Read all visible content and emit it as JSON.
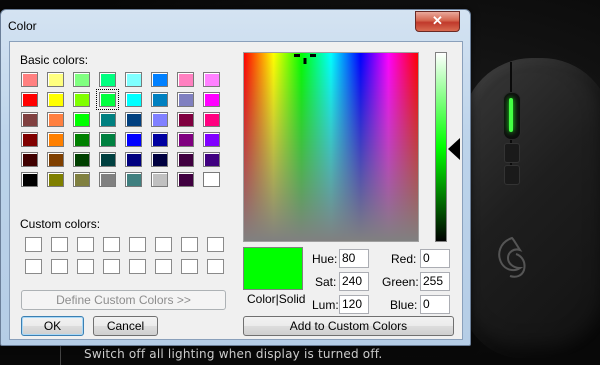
{
  "dialog": {
    "title": "Color",
    "close_glyph": "✕",
    "basic_colors_label": "Basic colors:",
    "custom_colors_label": "Custom colors:",
    "define_custom_label": "Define Custom Colors >>",
    "ok_label": "OK",
    "cancel_label": "Cancel",
    "color_solid_label": "Color|Solid",
    "add_custom_label": "Add to Custom Colors",
    "hue_label": "Hue:",
    "hue_value": "80",
    "sat_label": "Sat:",
    "sat_value": "240",
    "lum_label": "Lum:",
    "lum_value": "120",
    "red_label": "Red:",
    "red_value": "0",
    "green_label": "Green:",
    "green_value": "255",
    "blue_label": "Blue:",
    "blue_value": "0",
    "preview_color": "#00ff00",
    "selected_basic_index": 11,
    "basic_colors": [
      "#ff8080",
      "#ffff80",
      "#80ff80",
      "#00ff80",
      "#80ffff",
      "#0080ff",
      "#ff80c0",
      "#ff80ff",
      "#ff0000",
      "#ffff00",
      "#80ff00",
      "#00ff40",
      "#00ffff",
      "#0080c0",
      "#8080c0",
      "#ff00ff",
      "#804040",
      "#ff8040",
      "#00ff00",
      "#008080",
      "#004080",
      "#8080ff",
      "#800040",
      "#ff0080",
      "#800000",
      "#ff8000",
      "#008000",
      "#008040",
      "#0000ff",
      "#0000a0",
      "#800080",
      "#8000ff",
      "#400000",
      "#804000",
      "#004000",
      "#004040",
      "#000080",
      "#000040",
      "#400040",
      "#400080",
      "#000000",
      "#808000",
      "#808040",
      "#808080",
      "#408080",
      "#c0c0c0",
      "#400040",
      "#ffffff"
    ],
    "custom_colors": [
      "#ffffff",
      "#ffffff",
      "#ffffff",
      "#ffffff",
      "#ffffff",
      "#ffffff",
      "#ffffff",
      "#ffffff",
      "#ffffff",
      "#ffffff",
      "#ffffff",
      "#ffffff",
      "#ffffff",
      "#ffffff",
      "#ffffff",
      "#ffffff"
    ]
  },
  "background_app": {
    "status_text": "Switch off all lighting when display is turned off.",
    "accent_color": "#44ff44"
  }
}
